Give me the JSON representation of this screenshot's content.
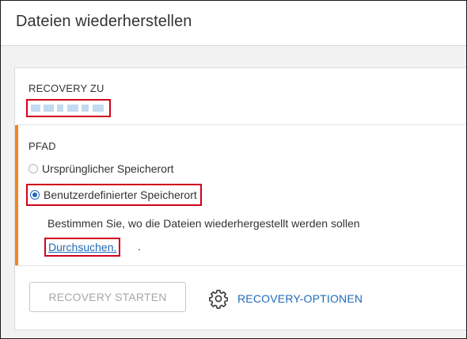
{
  "dialog": {
    "title": "Dateien wiederherstellen"
  },
  "recovery_to": {
    "label": "RECOVERY ZU"
  },
  "path": {
    "label": "PFAD",
    "options": [
      {
        "label": "Ursprünglicher Speicherort",
        "selected": false
      },
      {
        "label": "Benutzerdefinierter Speicherort",
        "selected": true
      }
    ],
    "hint": "Bestimmen Sie, wo die Dateien wiederhergestellt werden sollen",
    "browse_label": "Durchsuchen.",
    "browse_suffix": "."
  },
  "actions": {
    "start_label": "RECOVERY STARTEN",
    "options_label": "RECOVERY-OPTIONEN",
    "options_icon": "gear-icon"
  },
  "colors": {
    "accent": "#f5851f",
    "link": "#1f6bb8",
    "highlight": "#d0021b"
  }
}
